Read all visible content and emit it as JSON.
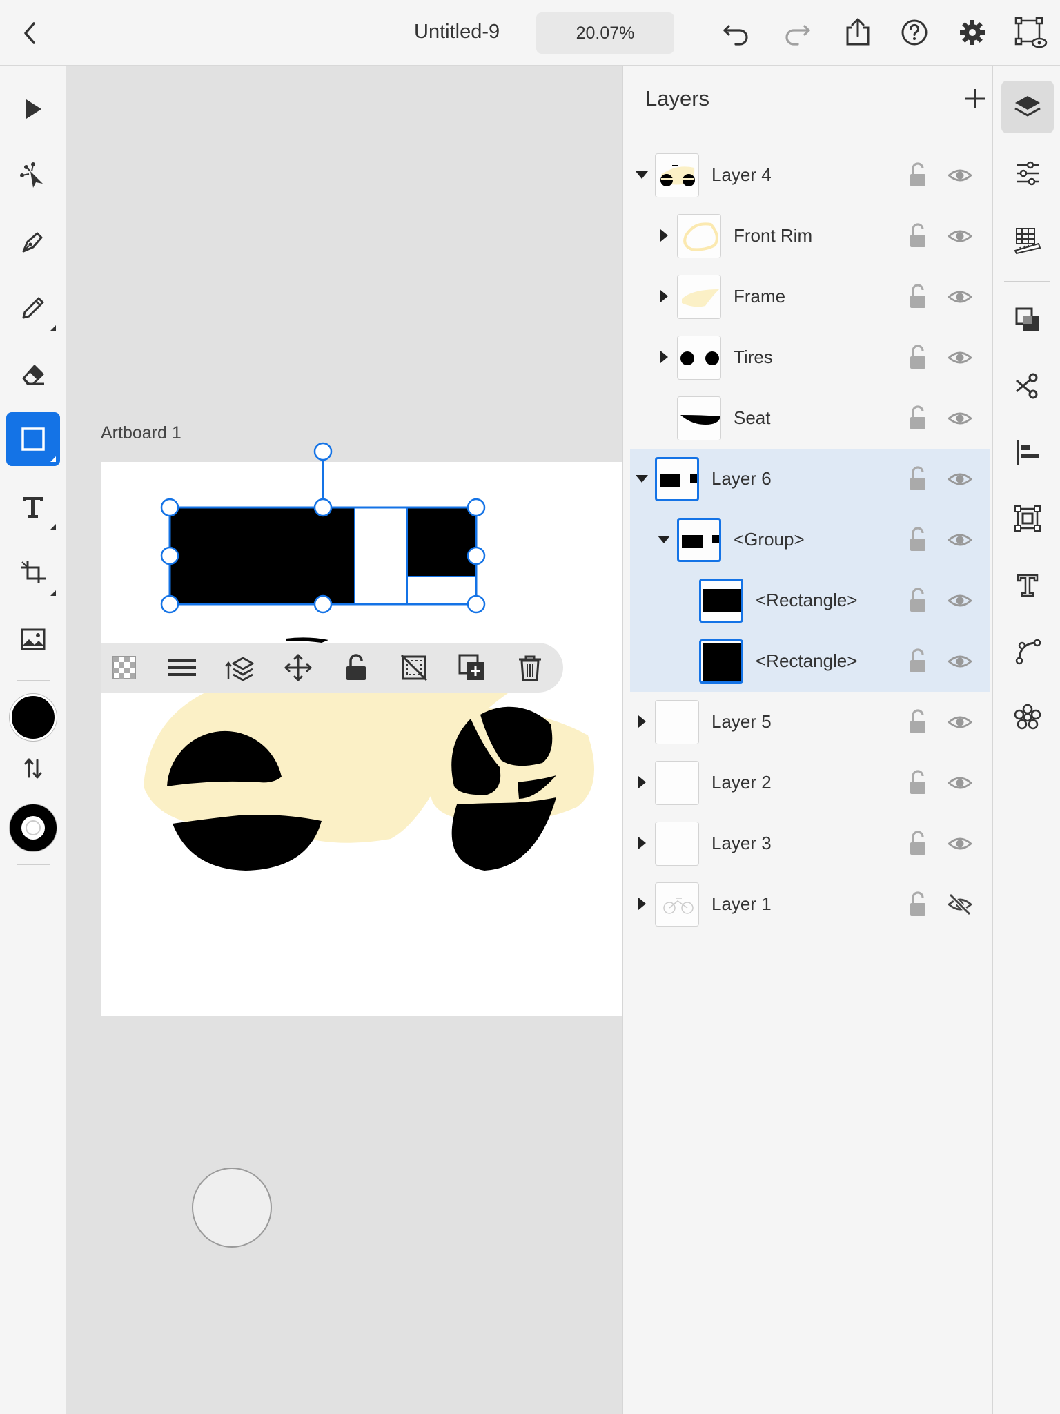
{
  "header": {
    "title": "Untitled-9",
    "zoom": "20.07%"
  },
  "canvas": {
    "artboard_label": "Artboard 1"
  },
  "layers_panel": {
    "title": "Layers",
    "layers": [
      {
        "name": "Layer 4",
        "depth": 0,
        "expanded": true,
        "selected": false,
        "visible": true
      },
      {
        "name": "Front Rim",
        "depth": 1,
        "expanded": false,
        "selected": false,
        "visible": true
      },
      {
        "name": "Frame",
        "depth": 1,
        "expanded": false,
        "selected": false,
        "visible": true
      },
      {
        "name": "Tires",
        "depth": 1,
        "expanded": false,
        "selected": false,
        "visible": true
      },
      {
        "name": "Seat",
        "depth": 1,
        "expanded": null,
        "selected": false,
        "visible": true
      },
      {
        "name": "Layer 6",
        "depth": 0,
        "expanded": true,
        "selected": true,
        "visible": true
      },
      {
        "name": "<Group>",
        "depth": 1,
        "expanded": true,
        "selected": true,
        "visible": true
      },
      {
        "name": "<Rectangle>",
        "depth": 2,
        "expanded": null,
        "selected": true,
        "visible": true
      },
      {
        "name": "<Rectangle>",
        "depth": 2,
        "expanded": null,
        "selected": true,
        "visible": true
      },
      {
        "name": "Layer 5",
        "depth": 0,
        "expanded": false,
        "selected": false,
        "visible": true
      },
      {
        "name": "Layer 2",
        "depth": 0,
        "expanded": false,
        "selected": false,
        "visible": true
      },
      {
        "name": "Layer 3",
        "depth": 0,
        "expanded": false,
        "selected": false,
        "visible": true
      },
      {
        "name": "Layer 1",
        "depth": 0,
        "expanded": false,
        "selected": false,
        "visible": false
      }
    ]
  },
  "colors": {
    "accent": "#1473e6",
    "bike_frame": "#fbf0c6",
    "fill": "#000000"
  },
  "tools": [
    "select-icon",
    "direct-select-icon",
    "pen-icon",
    "pencil-icon",
    "eraser-icon",
    "rectangle-icon",
    "type-icon",
    "crop-icon",
    "image-icon"
  ],
  "context_toolbar": [
    "opacity-icon",
    "align-icon",
    "arrange-icon",
    "transform-icon",
    "lock-icon",
    "mask-icon",
    "duplicate-icon",
    "delete-icon"
  ],
  "right_rail": [
    "layers-icon",
    "properties-icon",
    "grid-icon",
    "pathfinder-icon",
    "cut-icon",
    "align-icon",
    "transform-icon",
    "type-panel-icon",
    "path-icon",
    "repeat-icon"
  ]
}
